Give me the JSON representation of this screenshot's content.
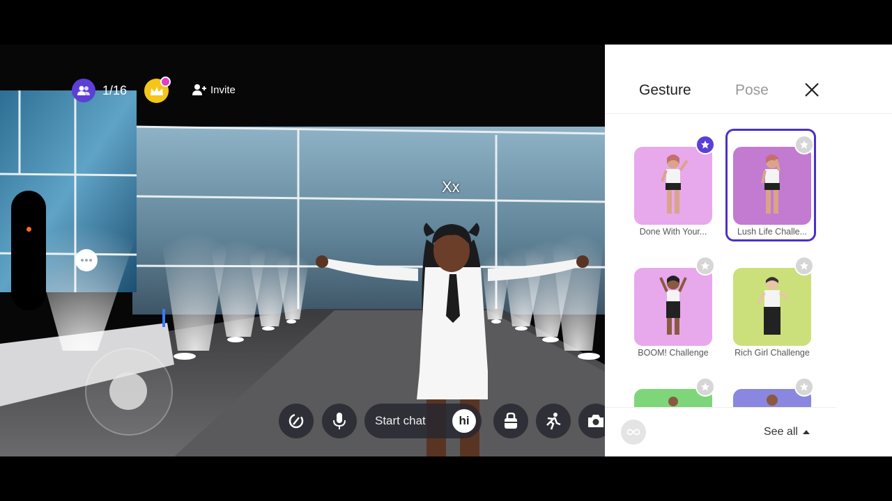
{
  "hud": {
    "player_count": "1/16",
    "invite_label": "Invite",
    "avatar_name": "Xx"
  },
  "bottom_bar": {
    "start_chat_label": "Start chat",
    "hi_label": "hi"
  },
  "panel": {
    "tabs": [
      {
        "label": "Gesture",
        "active": true
      },
      {
        "label": "Pose",
        "active": false
      }
    ],
    "items": [
      {
        "caption": "Done With Your...",
        "favorite": true,
        "selected": false,
        "bg": "#e8a8ec"
      },
      {
        "caption": "Lush Life Challe...",
        "favorite": false,
        "selected": true,
        "bg": "#c27bd0"
      },
      {
        "caption": "BOOM! Challenge",
        "favorite": false,
        "selected": false,
        "bg": "#e8a8ec"
      },
      {
        "caption": "Rich Girl Challenge",
        "favorite": false,
        "selected": false,
        "bg": "#cbe07a"
      },
      {
        "caption": "",
        "favorite": false,
        "selected": false,
        "bg": "#7fd67a"
      },
      {
        "caption": "",
        "favorite": false,
        "selected": false,
        "bg": "#8a87e0"
      }
    ],
    "see_all_label": "See all"
  },
  "colors": {
    "accent": "#5b3fd6",
    "crown": "#f5c518",
    "notification_dot": "#e43cc7"
  }
}
